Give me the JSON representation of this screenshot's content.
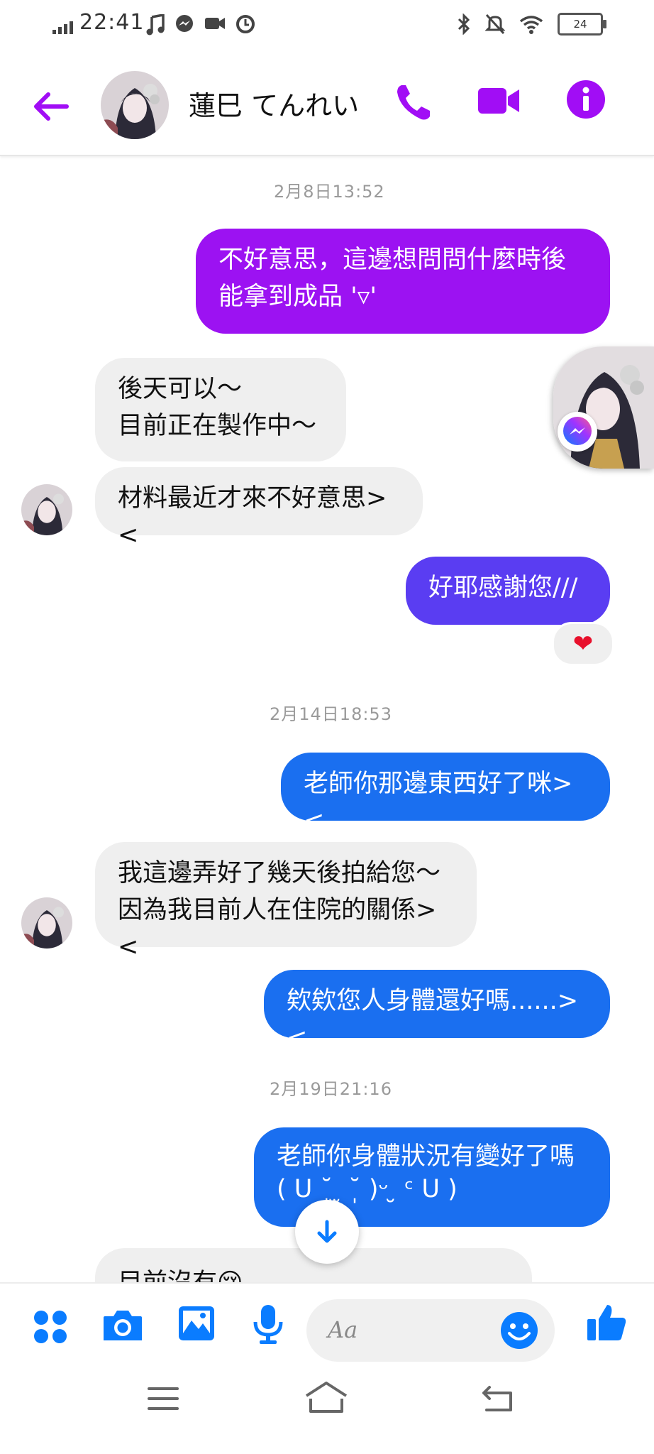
{
  "status_bar": {
    "time": "22:41",
    "battery": "24"
  },
  "header": {
    "name": "蓮巳 てんれい"
  },
  "messages": {
    "ts1": "2月8日13:52",
    "m1_line1": "不好意思，這邊想問問什麼時後",
    "m1_line2": "能拿到成品 '▿'",
    "m2_line1": "後天可以～",
    "m2_line2": "目前正在製作中～",
    "m3": "材料最近才來不好意思><",
    "m4": "好耶感謝您///",
    "m4_reaction": "❤",
    "ts2": "2月14日18:53",
    "m5": "老師你那邊東西好了咪><",
    "m6_line1": "我這邊弄好了幾天後拍給您～",
    "m6_line2": "因為我目前人在住院的關係><",
    "m7": "欸欸您人身體還好嗎......><",
    "ts3": "2月19日21:16",
    "m8_line1": "老師你身體狀況有變好了嗎",
    "m8_line2": "( U ˘̩  ̫ ˘̩ )ᵕ  ̮ ᶜ U )",
    "m9_partial": "目前沒有😢"
  },
  "composer": {
    "placeholder": "Aa"
  },
  "colors": {
    "accent_purple": "#a10df5",
    "bubble_purple": "#9c12f2",
    "bubble_indigo": "#5a3df2",
    "bubble_blue": "#1a6ff0",
    "composer_blue": "#0a7cff",
    "incoming_gray": "#efefef"
  }
}
